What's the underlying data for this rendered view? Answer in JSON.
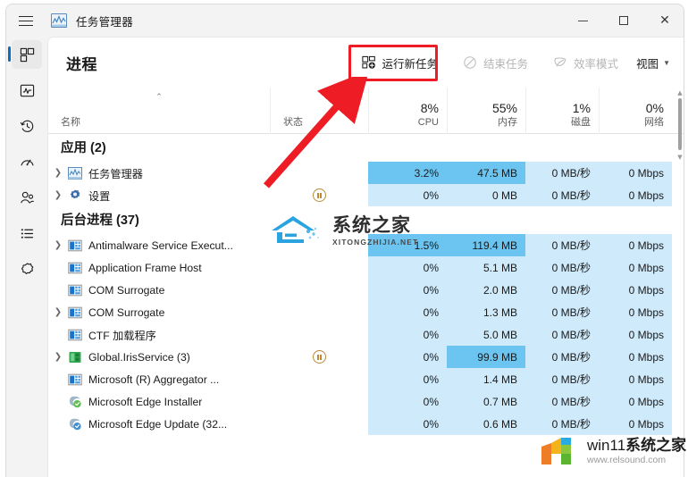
{
  "window": {
    "title": "任务管理器",
    "minimize_label": "最小化",
    "maximize_label": "最大化",
    "close_label": "关闭"
  },
  "sidebar": {
    "items": [
      {
        "name": "processes",
        "icon": "grid-icon",
        "label": "进程",
        "active": true
      },
      {
        "name": "performance",
        "icon": "pulse-icon",
        "label": "性能",
        "active": false
      },
      {
        "name": "app-history",
        "icon": "history-clock-icon",
        "label": "应用历史记录",
        "active": false
      },
      {
        "name": "startup-apps",
        "icon": "gauge-icon",
        "label": "启动应用",
        "active": false
      },
      {
        "name": "users",
        "icon": "users-icon",
        "label": "用户",
        "active": false
      },
      {
        "name": "details",
        "icon": "list-icon",
        "label": "详细信息",
        "active": false
      },
      {
        "name": "services",
        "icon": "gear-icon",
        "label": "服务",
        "active": false
      }
    ]
  },
  "toolbar": {
    "page_title": "进程",
    "run_new_task": "运行新任务",
    "end_task": "结束任务",
    "efficiency_mode": "效率模式",
    "view": "视图"
  },
  "columns": [
    {
      "key": "name",
      "label": "名称",
      "pct": "",
      "sorted": true
    },
    {
      "key": "status",
      "label": "状态",
      "pct": "",
      "sorted": false
    },
    {
      "key": "cpu",
      "label": "CPU",
      "pct": "8%",
      "sorted": false
    },
    {
      "key": "memory",
      "label": "内存",
      "pct": "55%",
      "sorted": false
    },
    {
      "key": "disk",
      "label": "磁盘",
      "pct": "1%",
      "sorted": false
    },
    {
      "key": "network",
      "label": "网络",
      "pct": "0%",
      "sorted": false
    }
  ],
  "groups": [
    {
      "label": "应用 (2)"
    },
    {
      "label": "后台进程 (37)"
    }
  ],
  "rows": [
    {
      "type": "group",
      "group_index": 0
    },
    {
      "type": "proc",
      "name": "任务管理器",
      "icon": "taskmgr-icon",
      "expandable": true,
      "status": "",
      "cpu": "3.2%",
      "memory": "47.5 MB",
      "disk": "0 MB/秒",
      "network": "0 Mbps",
      "shade": {
        "cpu": "mid",
        "memory": "mid",
        "disk": "light",
        "network": "light"
      }
    },
    {
      "type": "proc",
      "name": "设置",
      "icon": "settings-icon",
      "expandable": true,
      "status": "paused",
      "cpu": "0%",
      "memory": "0 MB",
      "disk": "0 MB/秒",
      "network": "0 Mbps",
      "shade": {
        "cpu": "light",
        "memory": "light",
        "disk": "light",
        "network": "light"
      }
    },
    {
      "type": "group",
      "group_index": 1
    },
    {
      "type": "proc",
      "name": "Antimalware Service Execut...",
      "icon": "generic-app-icon",
      "expandable": true,
      "status": "",
      "cpu": "1.5%",
      "memory": "119.4 MB",
      "disk": "0 MB/秒",
      "network": "0 Mbps",
      "shade": {
        "cpu": "mid",
        "memory": "mid",
        "disk": "light",
        "network": "light"
      }
    },
    {
      "type": "proc",
      "name": "Application Frame Host",
      "icon": "generic-app-icon",
      "expandable": false,
      "status": "",
      "cpu": "0%",
      "memory": "5.1 MB",
      "disk": "0 MB/秒",
      "network": "0 Mbps",
      "shade": {
        "cpu": "light",
        "memory": "light",
        "disk": "light",
        "network": "light"
      }
    },
    {
      "type": "proc",
      "name": "COM Surrogate",
      "icon": "generic-app-icon",
      "expandable": false,
      "status": "",
      "cpu": "0%",
      "memory": "2.0 MB",
      "disk": "0 MB/秒",
      "network": "0 Mbps",
      "shade": {
        "cpu": "light",
        "memory": "light",
        "disk": "light",
        "network": "light"
      }
    },
    {
      "type": "proc",
      "name": "COM Surrogate",
      "icon": "generic-app-icon",
      "expandable": true,
      "status": "",
      "cpu": "0%",
      "memory": "1.3 MB",
      "disk": "0 MB/秒",
      "network": "0 Mbps",
      "shade": {
        "cpu": "light",
        "memory": "light",
        "disk": "light",
        "network": "light"
      }
    },
    {
      "type": "proc",
      "name": "CTF 加载程序",
      "icon": "generic-app-icon",
      "expandable": false,
      "status": "",
      "cpu": "0%",
      "memory": "5.0 MB",
      "disk": "0 MB/秒",
      "network": "0 Mbps",
      "shade": {
        "cpu": "light",
        "memory": "light",
        "disk": "light",
        "network": "light"
      }
    },
    {
      "type": "proc",
      "name": "Global.IrisService (3)",
      "icon": "iris-icon",
      "expandable": true,
      "status": "paused",
      "cpu": "0%",
      "memory": "99.9 MB",
      "disk": "0 MB/秒",
      "network": "0 Mbps",
      "shade": {
        "cpu": "light",
        "memory": "mid",
        "disk": "light",
        "network": "light"
      }
    },
    {
      "type": "proc",
      "name": "Microsoft (R) Aggregator ...",
      "icon": "generic-app-icon",
      "expandable": false,
      "status": "",
      "cpu": "0%",
      "memory": "1.4 MB",
      "disk": "0 MB/秒",
      "network": "0 Mbps",
      "shade": {
        "cpu": "light",
        "memory": "light",
        "disk": "light",
        "network": "light"
      }
    },
    {
      "type": "proc",
      "name": "Microsoft Edge Installer",
      "icon": "edge-installer-icon",
      "expandable": false,
      "status": "",
      "cpu": "0%",
      "memory": "0.7 MB",
      "disk": "0 MB/秒",
      "network": "0 Mbps",
      "shade": {
        "cpu": "light",
        "memory": "light",
        "disk": "light",
        "network": "light"
      }
    },
    {
      "type": "proc",
      "name": "Microsoft Edge Update (32...",
      "icon": "edge-update-icon",
      "expandable": false,
      "status": "",
      "cpu": "0%",
      "memory": "0.6 MB",
      "disk": "0 MB/秒",
      "network": "0 Mbps",
      "shade": {
        "cpu": "light",
        "memory": "light",
        "disk": "light",
        "network": "light"
      }
    }
  ],
  "annotation": {
    "highlight_target": "运行新任务",
    "box_color": "#ee1c25",
    "arrow_color": "#ee1c25"
  },
  "watermarks": {
    "center_main": "系统之家",
    "center_sub": "XITONGZHIJIA.NET",
    "bottom_right_prefix": "win11",
    "bottom_right_main": "系统之家",
    "bottom_right_sub": "www.relsound.com"
  },
  "colors": {
    "accent": "#0f6cbd",
    "shade_light": "#cfeafb",
    "shade_mid": "#6cc5f0",
    "annotation": "#ee1c25"
  }
}
